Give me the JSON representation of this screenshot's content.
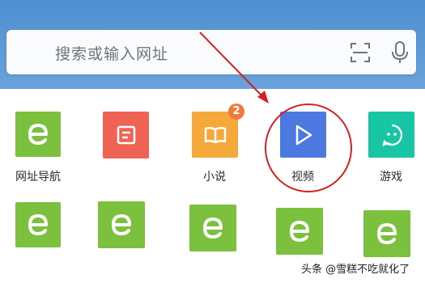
{
  "search": {
    "placeholder": "搜索或输入网址"
  },
  "icons": {
    "scan": "scan-icon",
    "mic": "microphone-icon",
    "e_logo": "e-browser-icon",
    "note": "note-icon",
    "book": "book-icon",
    "play": "play-icon",
    "game": "game-controller-icon"
  },
  "colors": {
    "header": "#4e8fd1",
    "green": "#7cc13d",
    "red": "#ef6354",
    "orange": "#f6a93b",
    "blue": "#4b79e0",
    "teal": "#18c6a5",
    "annotation": "#d92020"
  },
  "grid": {
    "row1": [
      {
        "label": "网址导航"
      },
      {
        "label": ""
      },
      {
        "label": "小说",
        "badge": "2"
      },
      {
        "label": "视频"
      },
      {
        "label": "游戏"
      }
    ],
    "row2": [
      {},
      {},
      {},
      {},
      {}
    ]
  },
  "watermark": {
    "text": "头条 @雪糕不吃就化了"
  }
}
